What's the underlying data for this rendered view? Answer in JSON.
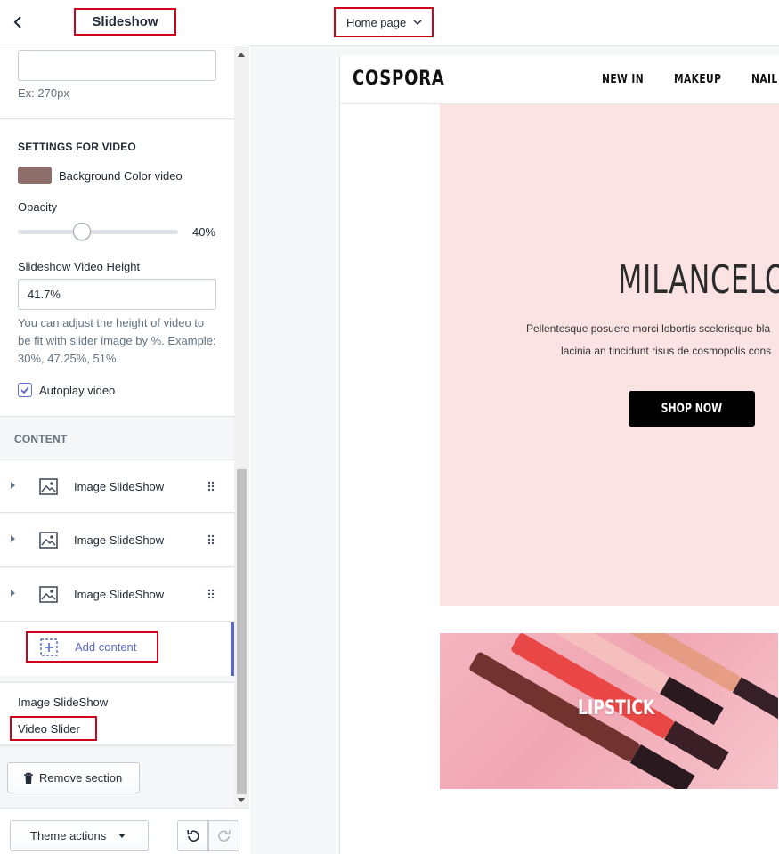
{
  "sidebar": {
    "title": "Slideshow",
    "settings": {
      "top_input_help": "Ex: 270px",
      "video_heading": "SETTINGS FOR VIDEO",
      "bg_color_label": "Background Color video",
      "bg_color": "#8d6e6a",
      "opacity_label": "Opacity",
      "opacity_value": "40%",
      "opacity_fraction": 0.4,
      "video_height_label": "Slideshow Video Height",
      "video_height_value": "41.7%",
      "video_height_help": "You can adjust the height of video to be fit with slider image by %. Example: 30%, 47.25%, 51%.",
      "autoplay_label": "Autoplay video",
      "autoplay_checked": true
    },
    "content": {
      "heading": "CONTENT",
      "blocks": [
        "Image SlideShow",
        "Image SlideShow",
        "Image SlideShow"
      ],
      "add_label": "Add content",
      "options": [
        "Image SlideShow",
        "Video Slider"
      ]
    },
    "remove_label": "Remove section",
    "theme_actions_label": "Theme actions"
  },
  "topbar": {
    "page_select": "Home page"
  },
  "preview": {
    "logo": "COSPORA",
    "nav": [
      "NEW IN",
      "MAKEUP",
      "NAIL"
    ],
    "hero_title": "MILANCELOS",
    "hero_line1": "Pellentesque posuere morci lobortis scelerisque bla",
    "hero_line2": "lacinia an tincidunt risus de cosmopolis cons",
    "hero_button": "SHOP NOW",
    "banner_label": "LIPSTICK"
  },
  "colors": {
    "highlight": "#d0021b",
    "accent": "#5c6ac4",
    "hero_bg": "#fbe3e4"
  }
}
